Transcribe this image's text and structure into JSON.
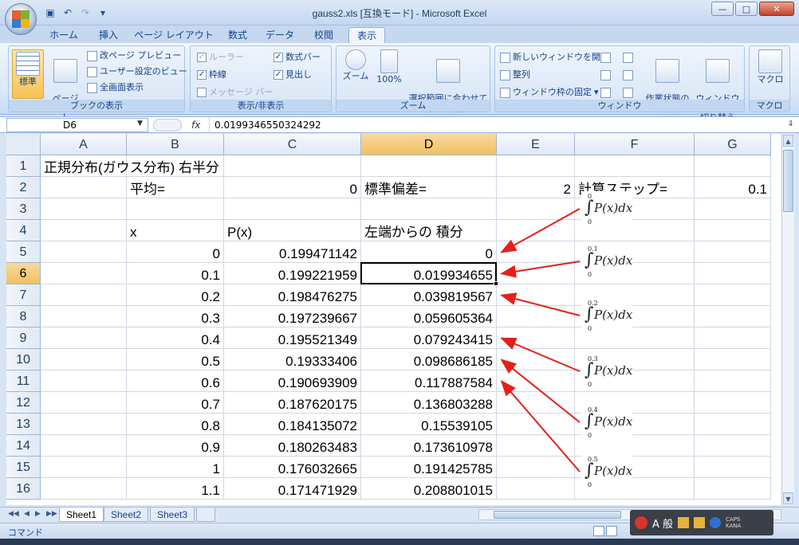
{
  "window": {
    "title": "gauss2.xls  [互換モード] - Microsoft Excel"
  },
  "qat": {
    "save_icon": "save-icon",
    "undo_icon": "undo-icon",
    "redo_icon": "redo-icon"
  },
  "tabs": [
    {
      "label": "ホーム"
    },
    {
      "label": "挿入"
    },
    {
      "label": "ページ レイアウト"
    },
    {
      "label": "数式"
    },
    {
      "label": "データ"
    },
    {
      "label": "校閲"
    },
    {
      "label": "表示"
    }
  ],
  "ribbon": {
    "book_view": {
      "title": "ブックの表示",
      "normal": "標準",
      "page_layout": "ページ\nレイアウト",
      "page_break_preview": "改ページ プレビュー",
      "custom_views": "ユーザー設定のビュー",
      "full_screen": "全画面表示"
    },
    "show_hide": {
      "title": "表示/非表示",
      "ruler": "ルーラー",
      "gridlines": "枠線",
      "message_bar": "メッセージ バー",
      "formula_bar": "数式バー",
      "headings": "見出し"
    },
    "zoom": {
      "title": "ズーム",
      "zoom": "ズーム",
      "zoom100": "100%",
      "zoom_selection": "選択範囲に合わせて\n拡大/縮小"
    },
    "window": {
      "title": "ウィンドウ",
      "new_window": "新しいウィンドウを開く",
      "arrange": "整列",
      "freeze": "ウィンドウ枠の固定",
      "save_workspace": "作業状態の\n保存",
      "switch_windows": "ウィンドウの\n切り替え"
    },
    "macro": {
      "title": "マクロ",
      "macro": "マクロ"
    }
  },
  "formula_bar": {
    "name_box": "D6",
    "fx": "fx",
    "value": "0.0199346550324292"
  },
  "columns": [
    "A",
    "B",
    "C",
    "D",
    "E",
    "F",
    "G"
  ],
  "rows": [
    {
      "num": "1",
      "A": "正規分布(ガウス分布) 右半分",
      "B": "",
      "C": "",
      "D": "",
      "E": "",
      "F": "",
      "G": ""
    },
    {
      "num": "2",
      "A": "",
      "B": "平均=",
      "C": "0",
      "D": "標準偏差=",
      "E": "2",
      "F": "計算ステップ=",
      "G": "0.1"
    },
    {
      "num": "3",
      "A": "",
      "B": "",
      "C": "",
      "D": "",
      "E": "",
      "F": "",
      "G": ""
    },
    {
      "num": "4",
      "A": "",
      "B": "x",
      "C": "P(x)",
      "D": "左端からの 積分",
      "E": "",
      "F": "",
      "G": ""
    },
    {
      "num": "5",
      "A": "",
      "B": "0",
      "C": "0.199471142",
      "D": "0",
      "E": "",
      "F": "",
      "G": ""
    },
    {
      "num": "6",
      "A": "",
      "B": "0.1",
      "C": "0.199221959",
      "D": "0.019934655",
      "E": "",
      "F": "",
      "G": ""
    },
    {
      "num": "7",
      "A": "",
      "B": "0.2",
      "C": "0.198476275",
      "D": "0.039819567",
      "E": "",
      "F": "",
      "G": ""
    },
    {
      "num": "8",
      "A": "",
      "B": "0.3",
      "C": "0.197239667",
      "D": "0.059605364",
      "E": "",
      "F": "",
      "G": ""
    },
    {
      "num": "9",
      "A": "",
      "B": "0.4",
      "C": "0.195521349",
      "D": "0.079243415",
      "E": "",
      "F": "",
      "G": ""
    },
    {
      "num": "10",
      "A": "",
      "B": "0.5",
      "C": "0.19333406",
      "D": "0.098686185",
      "E": "",
      "F": "",
      "G": ""
    },
    {
      "num": "11",
      "A": "",
      "B": "0.6",
      "C": "0.190693909",
      "D": "0.117887584",
      "E": "",
      "F": "",
      "G": ""
    },
    {
      "num": "12",
      "A": "",
      "B": "0.7",
      "C": "0.187620175",
      "D": "0.136803288",
      "E": "",
      "F": "",
      "G": ""
    },
    {
      "num": "13",
      "A": "",
      "B": "0.8",
      "C": "0.184135072",
      "D": "0.15539105",
      "E": "",
      "F": "",
      "G": ""
    },
    {
      "num": "14",
      "A": "",
      "B": "0.9",
      "C": "0.180263483",
      "D": "0.173610978",
      "E": "",
      "F": "",
      "G": ""
    },
    {
      "num": "15",
      "A": "",
      "B": "1",
      "C": "0.176032665",
      "D": "0.191425785",
      "E": "",
      "F": "",
      "G": ""
    },
    {
      "num": "16",
      "A": "",
      "B": "1.1",
      "C": "0.171471929",
      "D": "0.208801015",
      "E": "",
      "F": "",
      "G": ""
    }
  ],
  "selected": {
    "col": "D",
    "row": "6"
  },
  "annotations": [
    {
      "upper": "0",
      "lower": "0",
      "expr": "P(x)dx",
      "target_row": "5"
    },
    {
      "upper": "0.1",
      "lower": "0",
      "expr": "P(x)dx",
      "target_row": "6"
    },
    {
      "upper": "0.2",
      "lower": "0",
      "expr": "P(x)dx",
      "target_row": "7"
    },
    {
      "upper": "0.3",
      "lower": "0",
      "expr": "P(x)dx",
      "target_row": "9"
    },
    {
      "upper": "0.4",
      "lower": "0",
      "expr": "P(x)dx",
      "target_row": "10"
    },
    {
      "upper": "0.5",
      "lower": "0",
      "expr": "P(x)dx",
      "target_row": "11"
    }
  ],
  "arrow_color": "#e3211a",
  "sheets": [
    {
      "label": "Sheet1"
    },
    {
      "label": "Sheet2"
    },
    {
      "label": "Sheet3"
    }
  ],
  "status": {
    "mode": "コマンド"
  },
  "ime": {
    "label": "A 般",
    "caps": "CAPS",
    "kana": "KANA"
  }
}
